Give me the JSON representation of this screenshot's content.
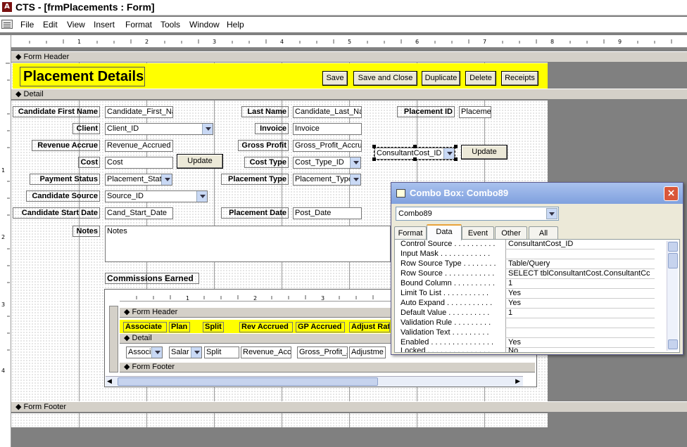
{
  "window": {
    "title": "CTS - [frmPlacements : Form]"
  },
  "menu": [
    "File",
    "Edit",
    "View",
    "Insert",
    "Format",
    "Tools",
    "Window",
    "Help"
  ],
  "rulers": {
    "top": [
      "1",
      "2",
      "3",
      "4",
      "5",
      "6",
      "7",
      "8",
      "9"
    ],
    "left": [
      "1",
      "2",
      "3",
      "4"
    ],
    "subform": [
      "1",
      "2",
      "3"
    ]
  },
  "bands": {
    "form_header": "Form Header",
    "detail": "Detail",
    "form_footer": "Form Footer"
  },
  "header": {
    "title": "Placement Details",
    "buttons": [
      "Save",
      "Save and Close",
      "Duplicate",
      "Delete",
      "Receipts"
    ]
  },
  "detail": {
    "labels": {
      "candidate_first_name": "Candidate First Name",
      "client": "Client",
      "revenue_accrue": "Revenue Accrue",
      "cost": "Cost",
      "payment_status": "Payment Status",
      "candidate_source": "Candidate Source",
      "candidate_start_date": "Candidate Start Date",
      "notes": "Notes",
      "last_name": "Last Name",
      "invoice": "Invoice",
      "gross_profit": "Gross Profit",
      "cost_type": "Cost Type",
      "placement_type": "Placement Type",
      "placement_date": "Placement Date",
      "placement_id": "Placement ID",
      "commissions_earned": "Commissions Earned"
    },
    "fields": {
      "candidate_first_name": "Candidate_First_Na",
      "client": "Client_ID",
      "revenue_accrue": "Revenue_Accrued",
      "cost": "Cost",
      "payment_status": "Placement_Stat",
      "candidate_source": "Source_ID",
      "candidate_start_date": "Cand_Start_Date",
      "notes": "Notes",
      "last_name": "Candidate_Last_Na",
      "invoice": "Invoice",
      "gross_profit": "Gross_Profit_Accru",
      "cost_type": "Cost_Type_ID",
      "placement_type": "Placement_Type",
      "placement_date": "Post_Date",
      "placement_id": "Placemen",
      "consultant_cost": "ConsultantCost_ID"
    },
    "update_button": "Update",
    "update_button_2": "Update"
  },
  "subform": {
    "header_labels": [
      "Associate",
      "Plan",
      "Split",
      "Rev Accrued",
      "GP Accrued",
      "Adjust Rat"
    ],
    "detail_fields": [
      "Associ",
      "Salar",
      "Split",
      "Revenue_Accr",
      "Gross_Profit_A",
      "Adjustme"
    ]
  },
  "dialog": {
    "title": "Combo Box: Combo89",
    "selected": "Combo89",
    "close": "×",
    "tabs": [
      "Format",
      "Data",
      "Event",
      "Other",
      "All"
    ],
    "active_tab": "Data",
    "properties": [
      {
        "name": "Control Source . . . . . . . . . .",
        "value": "ConsultantCost_ID"
      },
      {
        "name": "Input Mask . . . . . . . . . . . .",
        "value": ""
      },
      {
        "name": "Row Source Type . . . . . . . .",
        "value": "Table/Query"
      },
      {
        "name": "Row Source . . . . . . . . . . . .",
        "value": "SELECT tblConsultantCost.ConsultantCc"
      },
      {
        "name": "Bound Column . . . . . . . . . .",
        "value": "1"
      },
      {
        "name": "Limit To List . . . . . . . . . . .",
        "value": "Yes"
      },
      {
        "name": "Auto Expand . . . . . . . . . . .",
        "value": "Yes"
      },
      {
        "name": "Default Value . . . . . . . . . .",
        "value": "1"
      },
      {
        "name": "Validation Rule . . . . . . . . .",
        "value": ""
      },
      {
        "name": "Validation Text . . . . . . . . .",
        "value": ""
      },
      {
        "name": "Enabled . . . . . . . . . . . . . . .",
        "value": "Yes"
      },
      {
        "name": "Locked . . . . . . . . . . . . . . .",
        "value": "No"
      }
    ]
  }
}
